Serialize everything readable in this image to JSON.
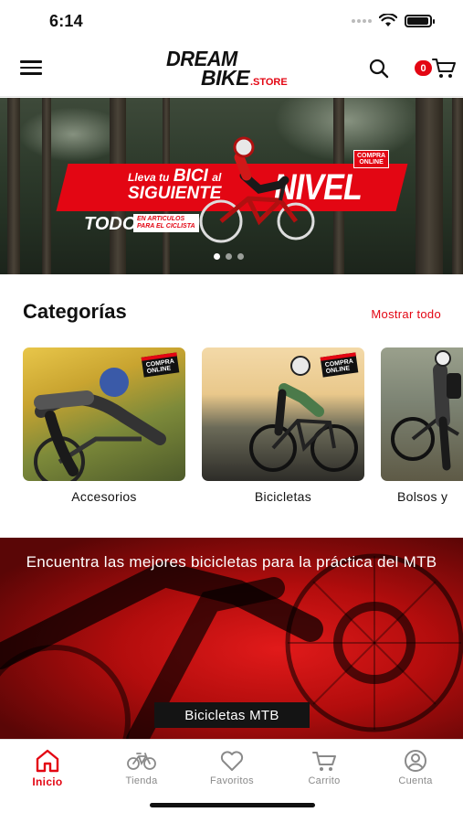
{
  "status_bar": {
    "time": "6:14",
    "battery_level": 0.9
  },
  "header": {
    "logo_line1": "DREAM",
    "logo_line2": "BIKE",
    "logo_suffix": ".STORE",
    "cart_count": "0",
    "icons": [
      "menu-icon",
      "search-icon",
      "cart-icon"
    ]
  },
  "hero": {
    "small_text": "Lleva tu",
    "highlight_1": "BICI",
    "small_text_2": "al",
    "highlight_2": "SIGUIENTE",
    "big_word": "NIVEL",
    "todo_text": "TODO",
    "articles_line1": "EN ARTICULOS",
    "articles_line2": "PARA EL CICLISTA",
    "badge_line1": "COMPRA",
    "badge_line2": "ONLINE",
    "slides": 3,
    "active_slide": 1
  },
  "categories": {
    "title": "Categorías",
    "show_all": "Mostrar todo",
    "badge_line1": "COMPRA",
    "badge_line2": "ONLINE",
    "items": [
      {
        "label": "Accesorios"
      },
      {
        "label": "Bicicletas"
      },
      {
        "label": "Bolsos y"
      }
    ]
  },
  "promo": {
    "title": "Encuentra las mejores bicicletas para la práctica del MTB",
    "button": "Bicicletas MTB"
  },
  "tab_bar": {
    "tabs": [
      {
        "label": "Inicio",
        "icon": "home-icon",
        "active": true
      },
      {
        "label": "Tienda",
        "icon": "bicycle-icon",
        "active": false
      },
      {
        "label": "Favoritos",
        "icon": "heart-icon",
        "active": false
      },
      {
        "label": "Carrito",
        "icon": "cart-icon",
        "active": false
      },
      {
        "label": "Cuenta",
        "icon": "user-icon",
        "active": false
      }
    ]
  },
  "colors": {
    "accent": "#e30613",
    "text": "#111111",
    "tab_inactive": "#8a8a8a"
  }
}
